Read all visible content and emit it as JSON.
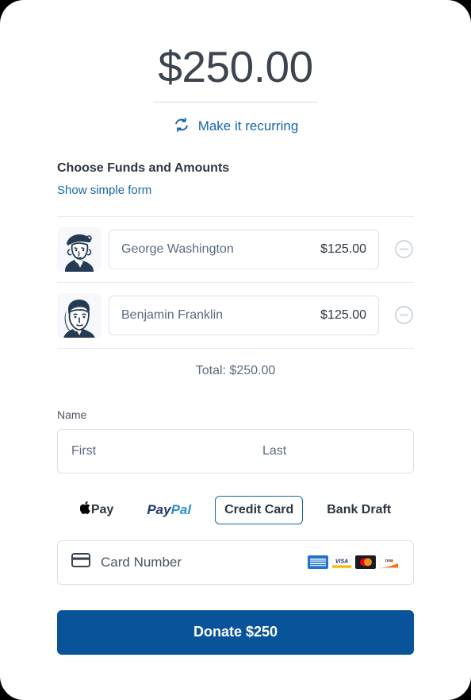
{
  "amount": {
    "display": "$250.00",
    "recurring_label": "Make it recurring",
    "recurring_icon": "refresh-recurring-icon"
  },
  "funds_section": {
    "heading": "Choose Funds and Amounts",
    "simple_form_link": "Show simple form",
    "rows": [
      {
        "name": "George Washington",
        "amount": "$125.00",
        "avatar_icon": "george-washington-portrait",
        "remove_icon": "minus-circle-icon"
      },
      {
        "name": "Benjamin Franklin",
        "amount": "$125.00",
        "avatar_icon": "benjamin-franklin-portrait",
        "remove_icon": "minus-circle-icon"
      }
    ],
    "total_label": "Total: $250.00"
  },
  "name_section": {
    "label": "Name",
    "first_placeholder": "First",
    "first_value": "",
    "last_placeholder": "Last",
    "last_value": ""
  },
  "payment": {
    "methods": [
      {
        "id": "apple-pay",
        "label": "Pay",
        "icon": "apple-icon",
        "selected": false
      },
      {
        "id": "paypal",
        "label_part1": "Pay",
        "label_part2": "Pal",
        "selected": false
      },
      {
        "id": "credit-card",
        "label": "Credit Card",
        "selected": true
      },
      {
        "id": "bank-draft",
        "label": "Bank Draft",
        "selected": false
      }
    ],
    "card_number_placeholder": "Card Number",
    "card_number_value": "",
    "card_icon": "credit-card-icon",
    "accepted_brands": [
      "amex",
      "visa",
      "mastercard",
      "discover"
    ]
  },
  "submit": {
    "label": "Donate $250"
  },
  "colors": {
    "accent_blue": "#1565a8",
    "button_blue": "#09539a",
    "text_dark": "#2d3540",
    "text_muted": "#5a6b80",
    "border": "#dde2e8"
  }
}
